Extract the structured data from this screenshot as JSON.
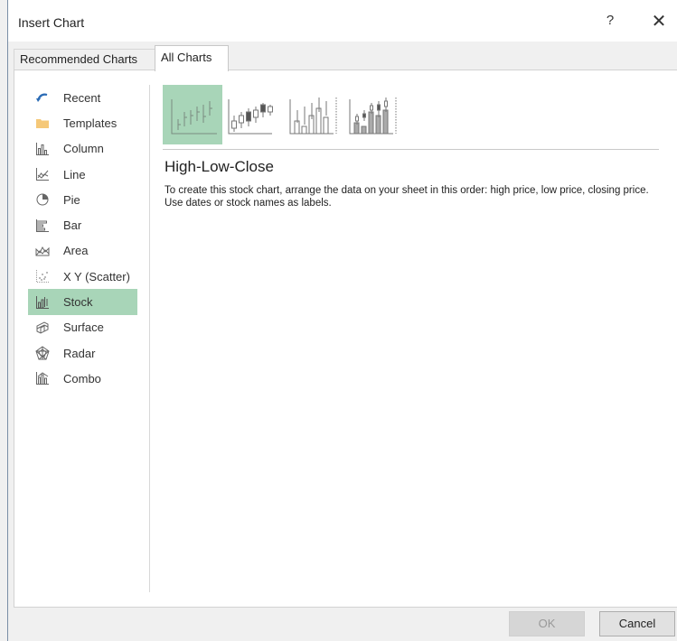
{
  "window": {
    "title": "Insert Chart",
    "help_label": "?",
    "close_label": "✕"
  },
  "tabs": [
    {
      "label": "Recommended Charts",
      "active": false
    },
    {
      "label": "All Charts",
      "active": true
    }
  ],
  "sidebar": {
    "items": [
      {
        "label": "Recent",
        "icon": "recent-icon"
      },
      {
        "label": "Templates",
        "icon": "folder-icon"
      },
      {
        "label": "Column",
        "icon": "column-chart-icon"
      },
      {
        "label": "Line",
        "icon": "line-chart-icon"
      },
      {
        "label": "Pie",
        "icon": "pie-chart-icon"
      },
      {
        "label": "Bar",
        "icon": "bar-chart-icon"
      },
      {
        "label": "Area",
        "icon": "area-chart-icon"
      },
      {
        "label": "X Y (Scatter)",
        "icon": "scatter-chart-icon"
      },
      {
        "label": "Stock",
        "icon": "stock-chart-icon",
        "selected": true
      },
      {
        "label": "Surface",
        "icon": "surface-chart-icon"
      },
      {
        "label": "Radar",
        "icon": "radar-chart-icon"
      },
      {
        "label": "Combo",
        "icon": "combo-chart-icon"
      }
    ]
  },
  "subtypes": [
    {
      "icon": "high-low-close-icon",
      "selected": true
    },
    {
      "icon": "open-high-low-close-icon",
      "selected": false
    },
    {
      "icon": "volume-high-low-close-icon",
      "selected": false
    },
    {
      "icon": "volume-open-high-low-close-icon",
      "selected": false
    }
  ],
  "details": {
    "title": "High-Low-Close",
    "description": "To create this stock chart, arrange the data on your sheet in this order: high price, low price, closing price. Use dates or stock names as labels."
  },
  "buttons": {
    "ok": "OK",
    "cancel": "Cancel",
    "ok_disabled": true
  },
  "colors": {
    "selection": "#a8d5b8",
    "folder": "#f5c878",
    "recent_arrow": "#2a6bb5"
  }
}
